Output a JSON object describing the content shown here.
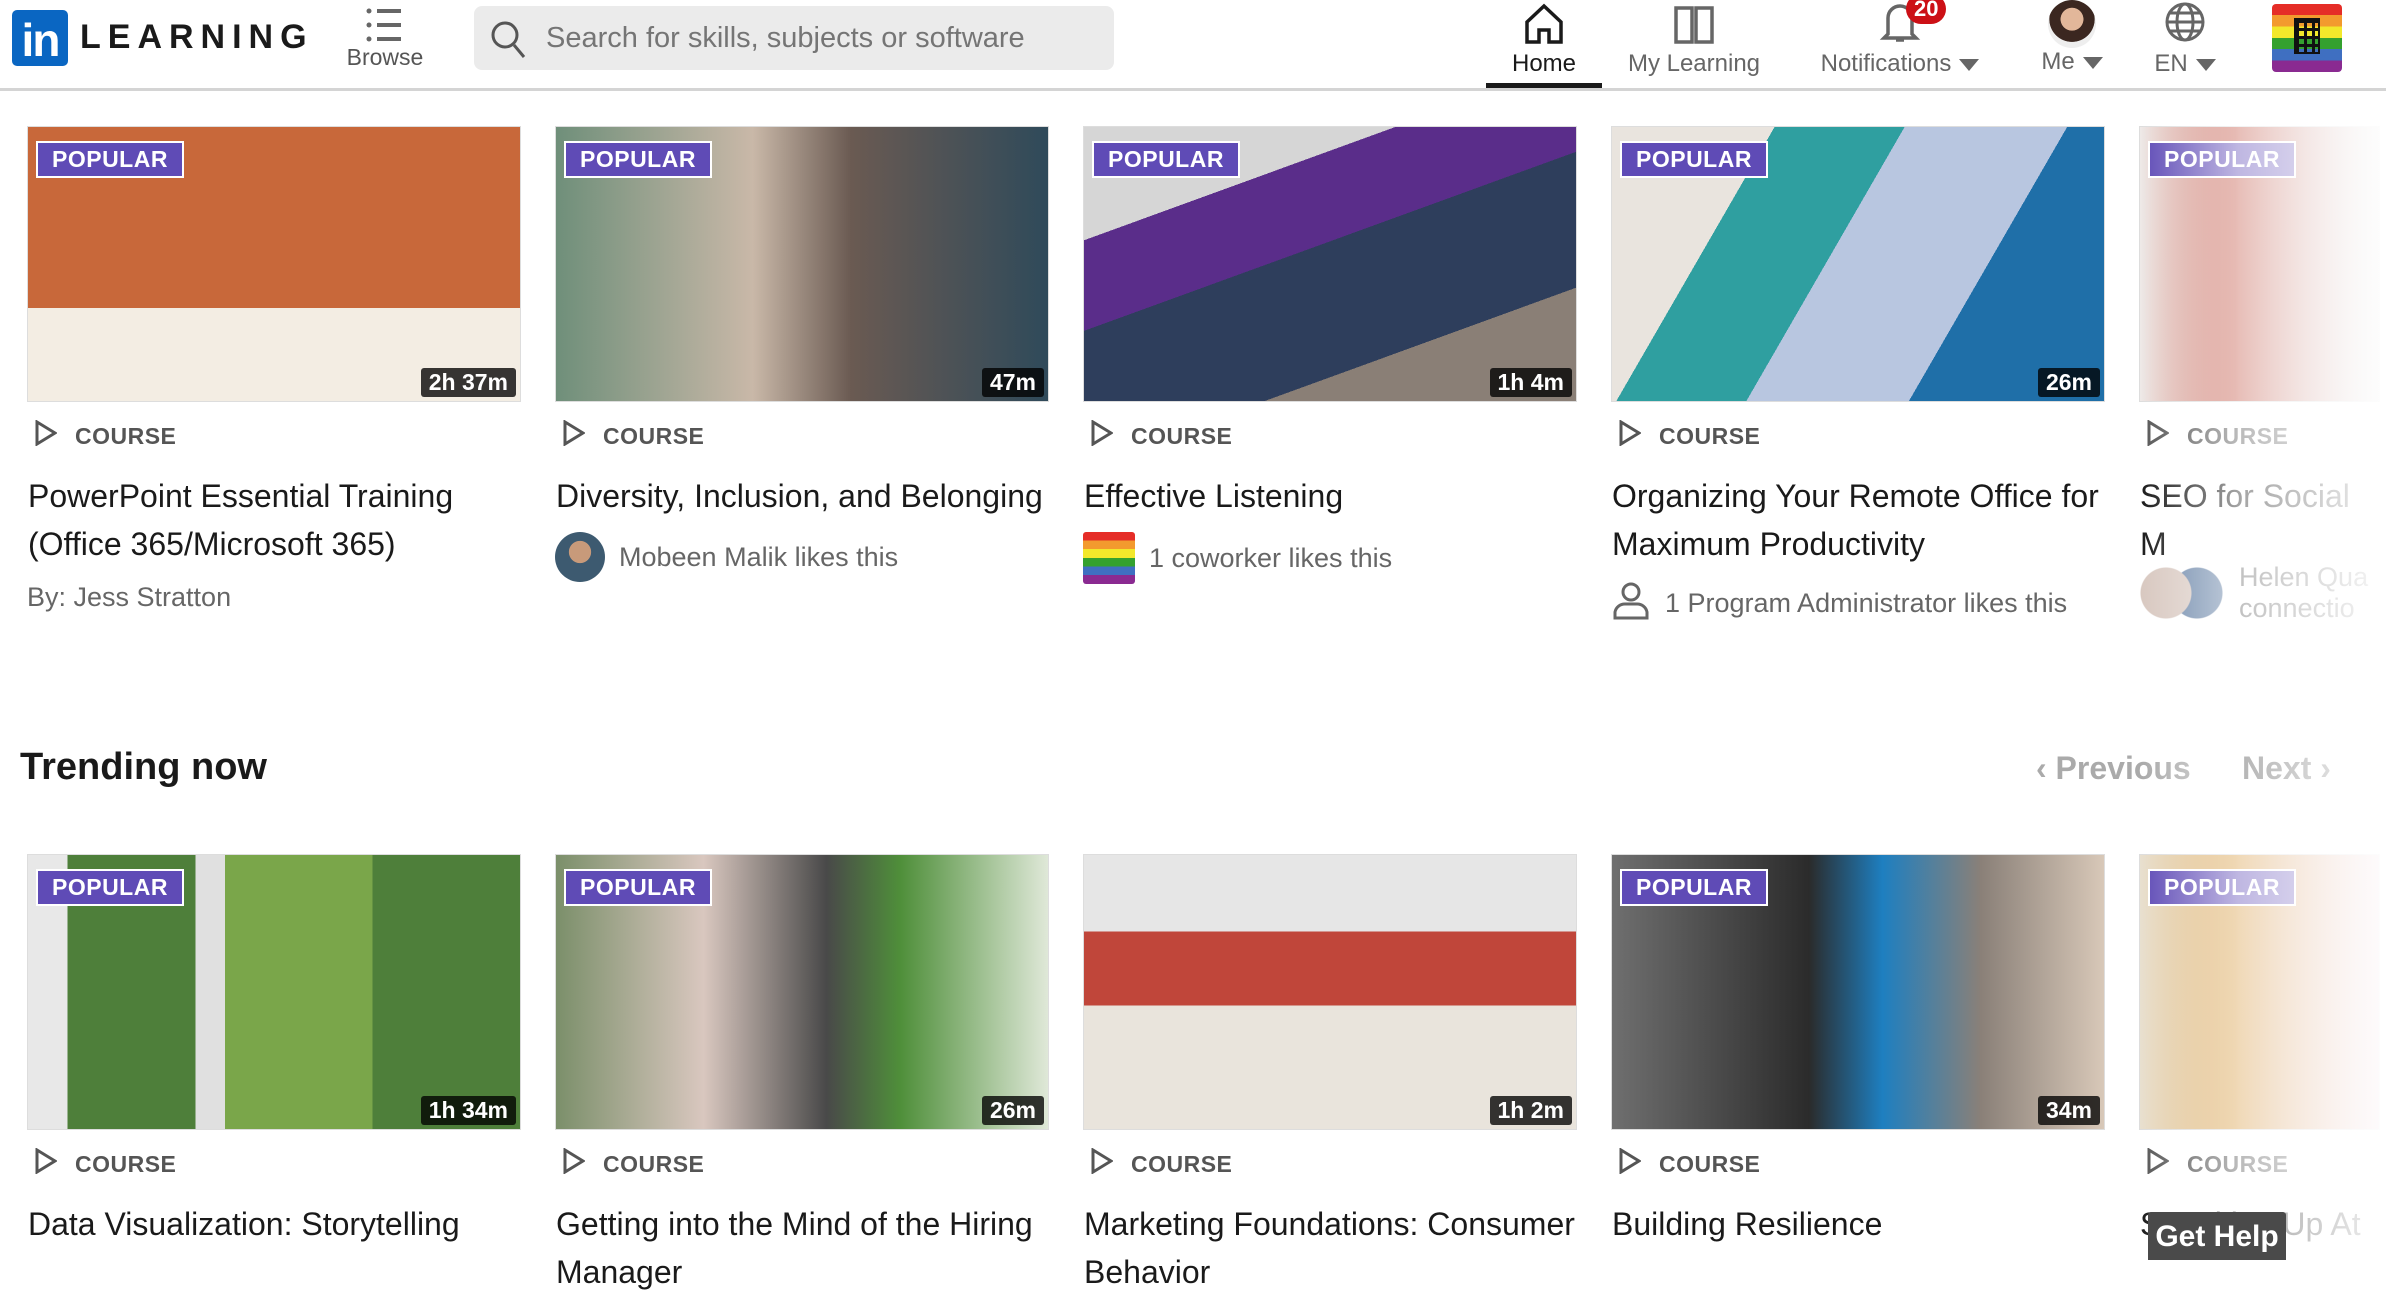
{
  "header": {
    "logo_in": "in",
    "logo_text": "LEARNING",
    "browse": "Browse",
    "search_placeholder": "Search for skills, subjects or software",
    "nav": {
      "home": "Home",
      "my_learning": "My Learning",
      "notifications": "Notifications",
      "notification_count": "20",
      "me": "Me",
      "language": "EN"
    }
  },
  "colors": {
    "popular_badge": "#5f4bb6",
    "brand": "#0a66c2",
    "notification_badge": "#cc1016"
  },
  "row1": [
    {
      "badge": "POPULAR",
      "duration": "2h 37m",
      "type": "COURSE",
      "title": "PowerPoint Essential Training (Office 365/Microsoft 365)",
      "meta": "By: Jess Stratton",
      "meta_icon": "none",
      "thumb": "linear-gradient(180deg,#c8683a 0 66%,#f3ede3 66%)"
    },
    {
      "badge": "POPULAR",
      "duration": "47m",
      "type": "COURSE",
      "title": "Diversity, Inclusion, and Belonging",
      "meta": "Mobeen Malik likes this",
      "meta_icon": "avatar",
      "thumb": "linear-gradient(90deg,#6f8f7a,#c9b8a8 40%,#6a5a52 60%,#2f4a5a)"
    },
    {
      "badge": "POPULAR",
      "duration": "1h 4m",
      "type": "COURSE",
      "title": "Effective Listening",
      "meta": "1 coworker likes this",
      "meta_icon": "pride",
      "thumb": "linear-gradient(160deg,#d6d6d6 0 25%,#5a2d8a 25% 45%,#2e3e5c 45% 75%,#8a7f76 75%)"
    },
    {
      "badge": "POPULAR",
      "duration": "26m",
      "type": "COURSE",
      "title": "Organizing Your Remote Office for Maximum Productivity",
      "meta": "1 Program Administrator likes this",
      "meta_icon": "person",
      "thumb": "linear-gradient(120deg,#e9e4de 0 25%,#2f9fa0 25% 45%,#b8c6e0 45% 70%,#1f6fa8 70%)"
    },
    {
      "badge": "POPULAR",
      "duration": "",
      "type": "COURSE",
      "title": "SEO for Social M",
      "meta": "Helen Qua connectio",
      "meta_icon": "two-avatars",
      "thumb": "linear-gradient(90deg,#eeeae8,#c45a4a 40%,#ddd)"
    }
  ],
  "section": {
    "title": "Trending now",
    "previous": "Previous",
    "next": "Next"
  },
  "row2": [
    {
      "badge": "POPULAR",
      "duration": "1h 34m",
      "type": "COURSE",
      "title": "Data Visualization: Storytelling",
      "thumb": "linear-gradient(90deg,#e8e8e8 0 8%,#4e7f3a 8% 34%,#e0e0e0 34% 40%,#7aa64a 40% 70%,#4e7f3a 70%)"
    },
    {
      "badge": "POPULAR",
      "duration": "26m",
      "type": "COURSE",
      "title": "Getting into the Mind of the Hiring Manager",
      "thumb": "linear-gradient(90deg,#7b8f6a,#d9c7bf 30%,#494949 55%,#4f8f3a 70%,#dfe8d8)"
    },
    {
      "badge": "",
      "duration": "1h 2m",
      "type": "COURSE",
      "title": "Marketing Foundations: Consumer Behavior",
      "thumb": "linear-gradient(180deg,#e6e6e6 0 28%,#c0463a 28% 55%,#e9e4dc 55%)"
    },
    {
      "badge": "POPULAR",
      "duration": "34m",
      "type": "COURSE",
      "title": "Building Resilience",
      "thumb": "linear-gradient(90deg,#6f6f6f,#2b2b2b 40%,#1e7fc0 55%,#8a8078 75%,#d8c8b8)"
    },
    {
      "badge": "POPULAR",
      "duration": "",
      "type": "COURSE",
      "title": "Speaking Up At",
      "thumb": "linear-gradient(90deg,#e8e0d0,#d9a04a 40%,#e8c0c8)"
    }
  ],
  "help": {
    "label": "Get Help"
  }
}
